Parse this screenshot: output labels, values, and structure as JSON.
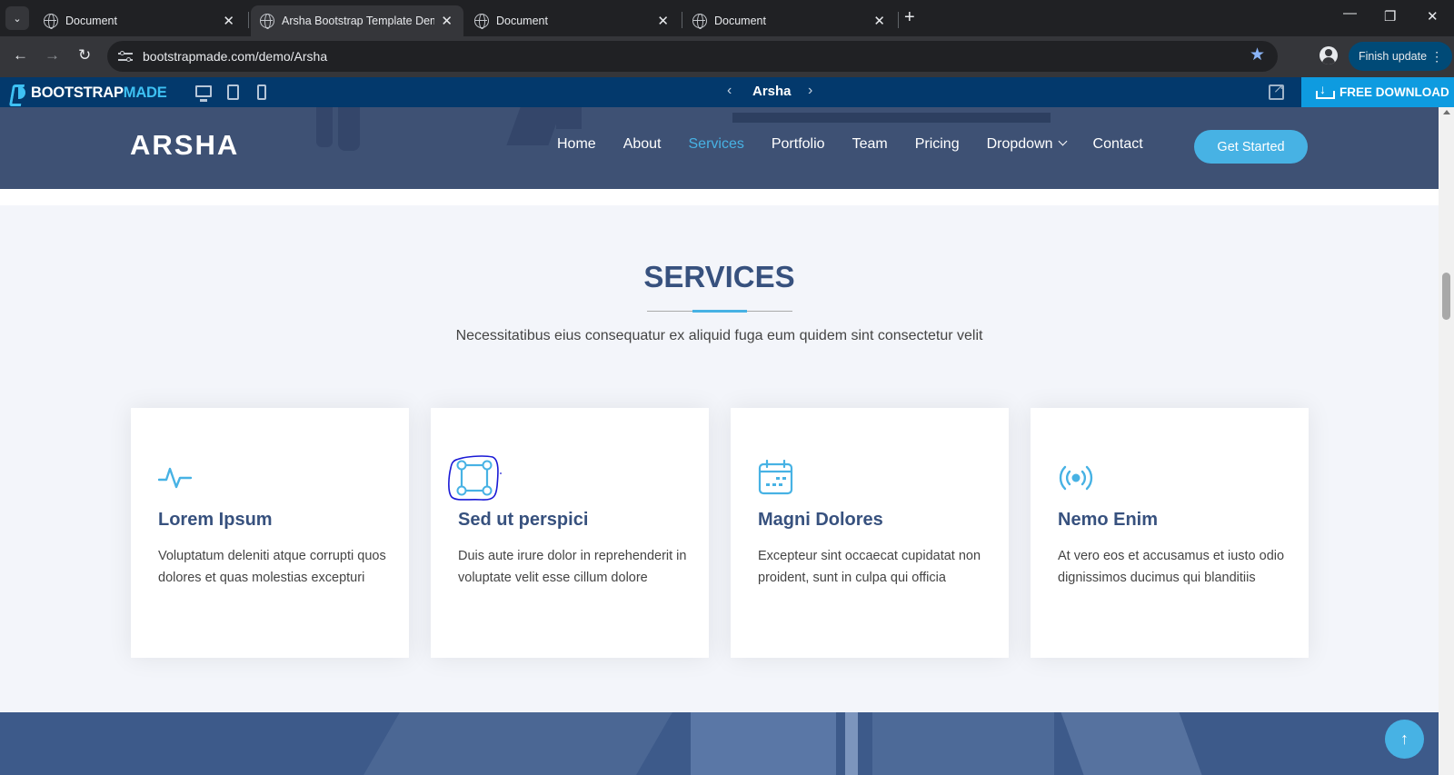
{
  "browser": {
    "tabs": [
      {
        "title": "Document",
        "active": false
      },
      {
        "title": "Arsha Bootstrap Template Demo",
        "active": true
      },
      {
        "title": "Document",
        "active": false
      },
      {
        "title": "Document",
        "active": false
      }
    ],
    "url": "bootstrapmade.com/demo/Arsha",
    "finish_update": "Finish update"
  },
  "bm_bar": {
    "logo_main": "BOOTSTRAP",
    "logo_accent": "MADE",
    "template_name": "Arsha",
    "free_download": "FREE DOWNLOAD"
  },
  "site": {
    "logo": "ARSHA",
    "nav": [
      {
        "label": "Home",
        "active": false
      },
      {
        "label": "About",
        "active": false
      },
      {
        "label": "Services",
        "active": true
      },
      {
        "label": "Portfolio",
        "active": false
      },
      {
        "label": "Team",
        "active": false
      },
      {
        "label": "Pricing",
        "active": false
      },
      {
        "label": "Dropdown",
        "active": false
      },
      {
        "label": "Contact",
        "active": false
      }
    ],
    "cta": "Get Started"
  },
  "services": {
    "title": "SERVICES",
    "subtitle": "Necessitatibus eius consequatur ex aliquid fuga eum quidem sint consectetur velit",
    "items": [
      {
        "icon": "activity-icon",
        "title": "Lorem Ipsum",
        "text": "Voluptatum deleniti atque corrupti quos dolores et quas molestias excepturi"
      },
      {
        "icon": "bounding-box-icon",
        "title": "Sed ut perspici",
        "text": "Duis aute irure dolor in reprehenderit in voluptate velit esse cillum dolore"
      },
      {
        "icon": "calendar-icon",
        "title": "Magni Dolores",
        "text": "Excepteur sint occaecat cupidatat non proident, sunt in culpa qui officia"
      },
      {
        "icon": "broadcast-icon",
        "title": "Nemo Enim",
        "text": "At vero eos et accusamus et iusto odio dignissimos ducimus qui blanditiis"
      }
    ]
  },
  "colors": {
    "accent": "#47b2e4",
    "heading": "#37517e",
    "header_bg": "#3e5174",
    "bm_bar": "#03396c",
    "annotation": "#1a1ad6"
  }
}
